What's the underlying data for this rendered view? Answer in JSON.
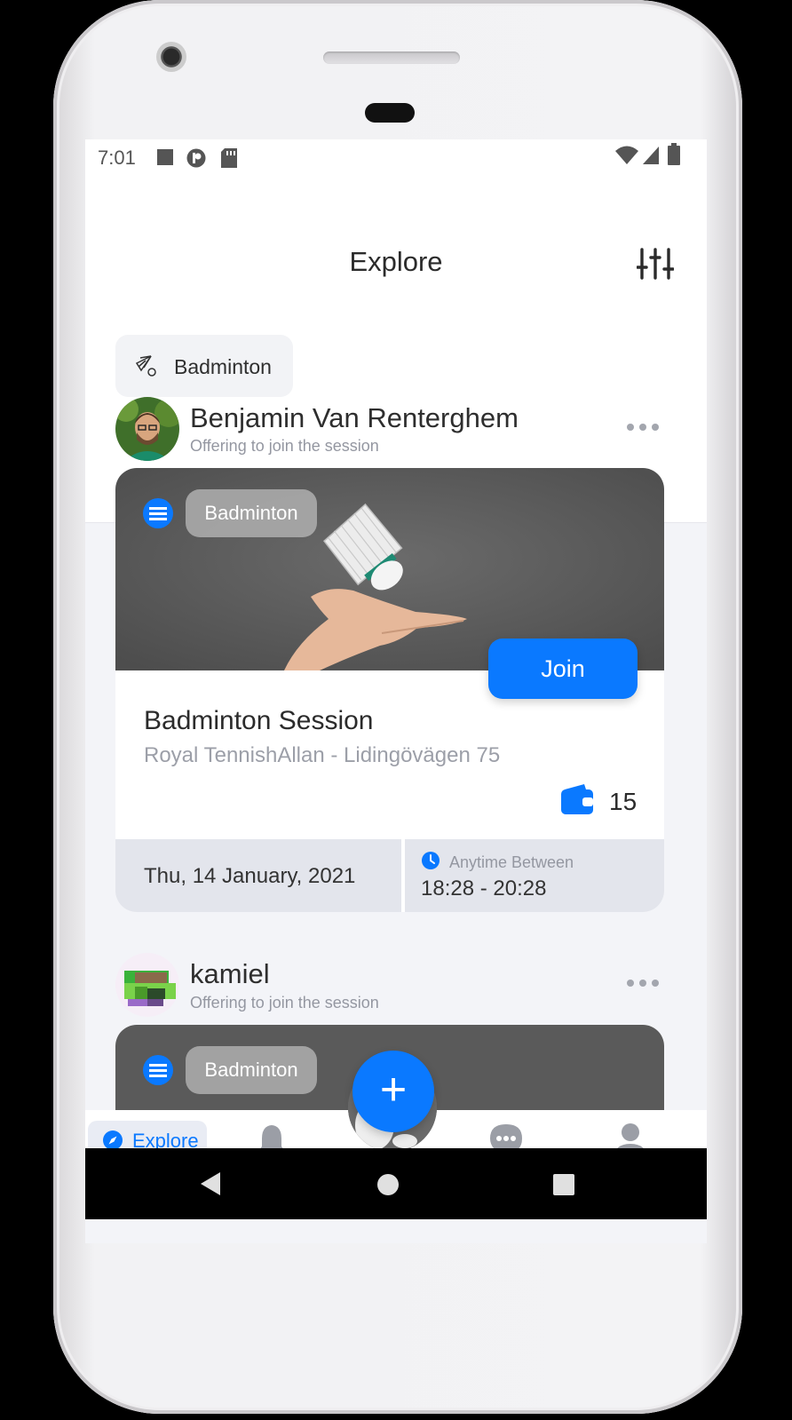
{
  "status_bar": {
    "time": "7:01"
  },
  "header": {
    "title": "Explore"
  },
  "filter_chip": {
    "label": "Badminton"
  },
  "posts": [
    {
      "author": "Benjamin Van Renterghem",
      "subtitle": "Offering to join the session",
      "sport_tag": "Badminton",
      "join_label": "Join",
      "title": "Badminton Session",
      "location": "Royal TennishAllan - Lidingövägen 75",
      "price": "15",
      "date": "Thu, 14 January, 2021",
      "time_label": "Anytime Between",
      "time_range": "18:28 - 20:28"
    },
    {
      "author": "kamiel",
      "subtitle": "Offering to join the session",
      "sport_tag": "Badminton"
    }
  ],
  "bottom_nav": {
    "explore_label": "Explore",
    "fab_label": "+",
    "items": [
      "explore-icon",
      "bell-icon",
      "add-icon",
      "chat-icon",
      "profile-icon"
    ]
  },
  "colors": {
    "accent": "#0a79ff",
    "card_footer": "#e3e5ec",
    "background": "#f3f4f8"
  }
}
